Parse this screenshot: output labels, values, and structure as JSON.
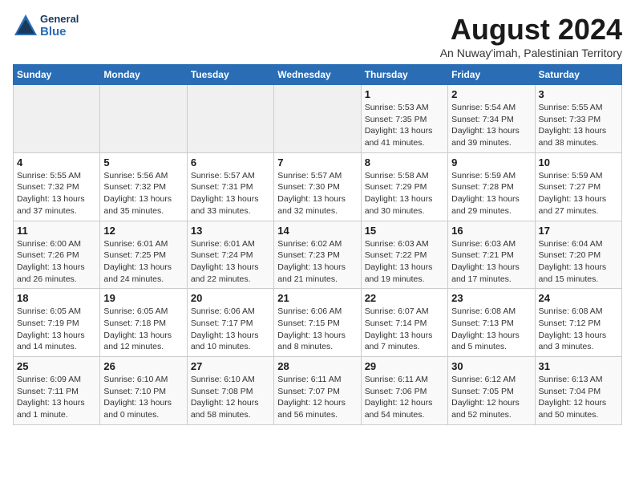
{
  "header": {
    "logo_general": "General",
    "logo_blue": "Blue",
    "title": "August 2024",
    "subtitle": "An Nuway'imah, Palestinian Territory"
  },
  "weekdays": [
    "Sunday",
    "Monday",
    "Tuesday",
    "Wednesday",
    "Thursday",
    "Friday",
    "Saturday"
  ],
  "weeks": [
    [
      {
        "day": "",
        "info": ""
      },
      {
        "day": "",
        "info": ""
      },
      {
        "day": "",
        "info": ""
      },
      {
        "day": "",
        "info": ""
      },
      {
        "day": "1",
        "info": "Sunrise: 5:53 AM\nSunset: 7:35 PM\nDaylight: 13 hours\nand 41 minutes."
      },
      {
        "day": "2",
        "info": "Sunrise: 5:54 AM\nSunset: 7:34 PM\nDaylight: 13 hours\nand 39 minutes."
      },
      {
        "day": "3",
        "info": "Sunrise: 5:55 AM\nSunset: 7:33 PM\nDaylight: 13 hours\nand 38 minutes."
      }
    ],
    [
      {
        "day": "4",
        "info": "Sunrise: 5:55 AM\nSunset: 7:32 PM\nDaylight: 13 hours\nand 37 minutes."
      },
      {
        "day": "5",
        "info": "Sunrise: 5:56 AM\nSunset: 7:32 PM\nDaylight: 13 hours\nand 35 minutes."
      },
      {
        "day": "6",
        "info": "Sunrise: 5:57 AM\nSunset: 7:31 PM\nDaylight: 13 hours\nand 33 minutes."
      },
      {
        "day": "7",
        "info": "Sunrise: 5:57 AM\nSunset: 7:30 PM\nDaylight: 13 hours\nand 32 minutes."
      },
      {
        "day": "8",
        "info": "Sunrise: 5:58 AM\nSunset: 7:29 PM\nDaylight: 13 hours\nand 30 minutes."
      },
      {
        "day": "9",
        "info": "Sunrise: 5:59 AM\nSunset: 7:28 PM\nDaylight: 13 hours\nand 29 minutes."
      },
      {
        "day": "10",
        "info": "Sunrise: 5:59 AM\nSunset: 7:27 PM\nDaylight: 13 hours\nand 27 minutes."
      }
    ],
    [
      {
        "day": "11",
        "info": "Sunrise: 6:00 AM\nSunset: 7:26 PM\nDaylight: 13 hours\nand 26 minutes."
      },
      {
        "day": "12",
        "info": "Sunrise: 6:01 AM\nSunset: 7:25 PM\nDaylight: 13 hours\nand 24 minutes."
      },
      {
        "day": "13",
        "info": "Sunrise: 6:01 AM\nSunset: 7:24 PM\nDaylight: 13 hours\nand 22 minutes."
      },
      {
        "day": "14",
        "info": "Sunrise: 6:02 AM\nSunset: 7:23 PM\nDaylight: 13 hours\nand 21 minutes."
      },
      {
        "day": "15",
        "info": "Sunrise: 6:03 AM\nSunset: 7:22 PM\nDaylight: 13 hours\nand 19 minutes."
      },
      {
        "day": "16",
        "info": "Sunrise: 6:03 AM\nSunset: 7:21 PM\nDaylight: 13 hours\nand 17 minutes."
      },
      {
        "day": "17",
        "info": "Sunrise: 6:04 AM\nSunset: 7:20 PM\nDaylight: 13 hours\nand 15 minutes."
      }
    ],
    [
      {
        "day": "18",
        "info": "Sunrise: 6:05 AM\nSunset: 7:19 PM\nDaylight: 13 hours\nand 14 minutes."
      },
      {
        "day": "19",
        "info": "Sunrise: 6:05 AM\nSunset: 7:18 PM\nDaylight: 13 hours\nand 12 minutes."
      },
      {
        "day": "20",
        "info": "Sunrise: 6:06 AM\nSunset: 7:17 PM\nDaylight: 13 hours\nand 10 minutes."
      },
      {
        "day": "21",
        "info": "Sunrise: 6:06 AM\nSunset: 7:15 PM\nDaylight: 13 hours\nand 8 minutes."
      },
      {
        "day": "22",
        "info": "Sunrise: 6:07 AM\nSunset: 7:14 PM\nDaylight: 13 hours\nand 7 minutes."
      },
      {
        "day": "23",
        "info": "Sunrise: 6:08 AM\nSunset: 7:13 PM\nDaylight: 13 hours\nand 5 minutes."
      },
      {
        "day": "24",
        "info": "Sunrise: 6:08 AM\nSunset: 7:12 PM\nDaylight: 13 hours\nand 3 minutes."
      }
    ],
    [
      {
        "day": "25",
        "info": "Sunrise: 6:09 AM\nSunset: 7:11 PM\nDaylight: 13 hours\nand 1 minute."
      },
      {
        "day": "26",
        "info": "Sunrise: 6:10 AM\nSunset: 7:10 PM\nDaylight: 13 hours\nand 0 minutes."
      },
      {
        "day": "27",
        "info": "Sunrise: 6:10 AM\nSunset: 7:08 PM\nDaylight: 12 hours\nand 58 minutes."
      },
      {
        "day": "28",
        "info": "Sunrise: 6:11 AM\nSunset: 7:07 PM\nDaylight: 12 hours\nand 56 minutes."
      },
      {
        "day": "29",
        "info": "Sunrise: 6:11 AM\nSunset: 7:06 PM\nDaylight: 12 hours\nand 54 minutes."
      },
      {
        "day": "30",
        "info": "Sunrise: 6:12 AM\nSunset: 7:05 PM\nDaylight: 12 hours\nand 52 minutes."
      },
      {
        "day": "31",
        "info": "Sunrise: 6:13 AM\nSunset: 7:04 PM\nDaylight: 12 hours\nand 50 minutes."
      }
    ]
  ]
}
